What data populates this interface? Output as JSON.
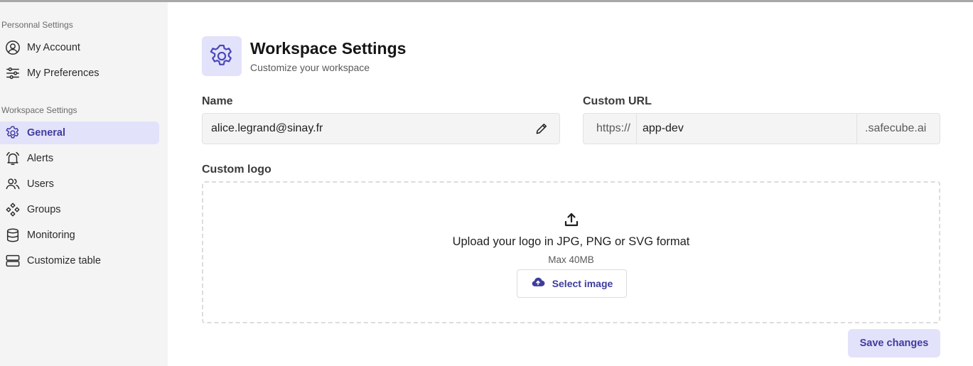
{
  "sidebar": {
    "personal_title": "Personnal Settings",
    "personal_items": [
      {
        "label": "My Account",
        "icon": "user-circle-icon"
      },
      {
        "label": "My Preferences",
        "icon": "sliders-icon"
      }
    ],
    "workspace_title": "Workspace Settings",
    "workspace_items": [
      {
        "label": "General",
        "icon": "gear-icon",
        "active": true
      },
      {
        "label": "Alerts",
        "icon": "bell-icon"
      },
      {
        "label": "Users",
        "icon": "users-icon"
      },
      {
        "label": "Groups",
        "icon": "groups-icon"
      },
      {
        "label": "Monitoring",
        "icon": "database-icon"
      },
      {
        "label": "Customize table",
        "icon": "table-rows-icon"
      }
    ]
  },
  "header": {
    "title": "Workspace Settings",
    "subtitle": "Customize your workspace",
    "icon": "gear-icon"
  },
  "form": {
    "name_label": "Name",
    "name_value": "alice.legrand@sinay.fr",
    "custom_url_label": "Custom URL",
    "url_prefix": "https://",
    "url_value": "app-dev",
    "url_suffix": ".safecube.ai",
    "logo_label": "Custom logo",
    "upload_text": "Upload your logo in JPG, PNG or SVG format",
    "upload_limit": "Max 40MB",
    "select_image_label": "Select image"
  },
  "actions": {
    "save_label": "Save changes"
  },
  "colors": {
    "accent": "#3f3c9e",
    "accent_light": "#e3e2fb",
    "sidebar_bg": "#f4f4f4"
  }
}
